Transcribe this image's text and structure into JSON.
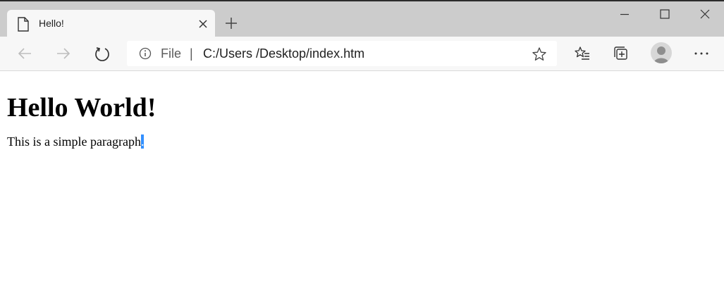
{
  "tab": {
    "title": "Hello!"
  },
  "address_bar": {
    "scheme": "File",
    "separator": "|",
    "url": "C:/Users /Desktop/index.htm"
  },
  "page": {
    "heading": "Hello World!",
    "paragraph": "This is a simple paragraph",
    "selected_text": "."
  },
  "colors": {
    "accent": "#3390ff",
    "titlebar": "#cccccc",
    "toolbar": "#f7f7f7"
  },
  "icons": [
    "document-icon",
    "close-icon",
    "plus-icon",
    "minimize-icon",
    "maximize-icon",
    "window-close-icon",
    "back-arrow-icon",
    "forward-arrow-icon",
    "refresh-icon",
    "info-icon",
    "favorite-star-icon",
    "favorites-list-icon",
    "collections-icon",
    "profile-avatar",
    "more-icon"
  ]
}
